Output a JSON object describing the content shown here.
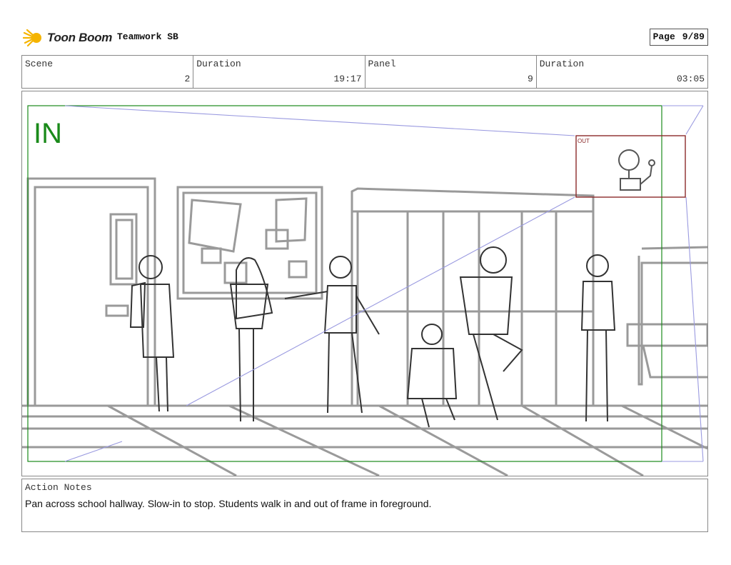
{
  "header": {
    "logo_text": "Toon Boom",
    "project_title": "Teamwork SB",
    "page_label": "Page",
    "page_value": "9/89"
  },
  "info": {
    "scene_label": "Scene",
    "scene_value": "2",
    "duration_label": "Duration",
    "duration_value": "19:17",
    "panel_label": "Panel",
    "panel_value": "9",
    "panel_duration_label": "Duration",
    "panel_duration_value": "03:05"
  },
  "panel": {
    "in_label": "IN",
    "out_label": "OUT",
    "in_color": "#1a8a1a",
    "out_color": "#8b2a2a",
    "motion_color": "#9a9ae0"
  },
  "notes": {
    "label": "Action Notes",
    "text": "Pan across school hallway. Slow-in to stop. Students walk in and out of frame in foreground."
  }
}
